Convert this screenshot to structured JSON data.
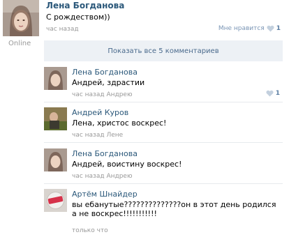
{
  "post": {
    "author": "Лена Богданова",
    "text": "С рождеством))",
    "time": "час назад",
    "online": "Online",
    "like_label": "Мне нравится",
    "like_count": "1"
  },
  "show_all": "Показать все 5 комментариев",
  "comments": [
    {
      "author": "Лена Богданова",
      "text": "Андрей, здрастии",
      "time": "час назад",
      "reply_to": "Андрею",
      "like_count": "1"
    },
    {
      "author": "Андрей Куров",
      "text": "Лена, христос воскрес!",
      "time": "час назад",
      "reply_to": "Лене"
    },
    {
      "author": "Лена Богданова",
      "text": "Андрей, воистину воскрес!",
      "time": "час назад",
      "reply_to": "Андрею"
    },
    {
      "author": "Артём Шнайдер",
      "text": "вы ебанутые??????????????он в этот день родился а не воскрес!!!!!!!!!!!",
      "time": "только что"
    }
  ],
  "colors": {
    "link": "#2b587a",
    "muted": "#999999",
    "button_bg": "#edf1f5",
    "like": "#5b7ea3"
  }
}
